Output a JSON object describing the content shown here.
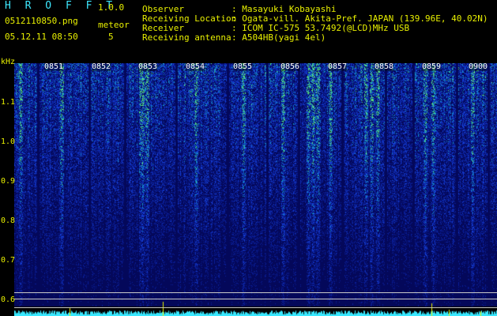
{
  "app": {
    "title": "H R O F F T",
    "version": "1.0.0"
  },
  "file": {
    "name": "0512110850.png",
    "datetime": "05.12.11 08:50"
  },
  "meteor": {
    "label": "meteor",
    "count": "5"
  },
  "info": [
    {
      "key": "Observer",
      "value": ": Masayuki Kobayashi"
    },
    {
      "key": "Receiving Location",
      "value": ": Ogata-vill. Akita-Pref. JAPAN (139.96E, 40.02N)"
    },
    {
      "key": "Receiver",
      "value": ": ICOM IC-575 53.7492(@LCD)MHz USB"
    },
    {
      "key": "Receiving antenna",
      "value": ": A504HB(yagi 4el)"
    }
  ],
  "y_axis": {
    "unit": "kHz",
    "ticks": [
      "1.1",
      "1.0",
      "0.9",
      "0.8",
      "0.7",
      "0.6"
    ]
  },
  "time_labels": [
    "0851",
    "0852",
    "0853",
    "0854",
    "0855",
    "0856",
    "0857",
    "0858",
    "0859",
    "0900"
  ],
  "colors": {
    "text": "#e8f000",
    "title": "#3ee8ff",
    "background": "#000000",
    "spectrogram_base": "#050a6a"
  }
}
